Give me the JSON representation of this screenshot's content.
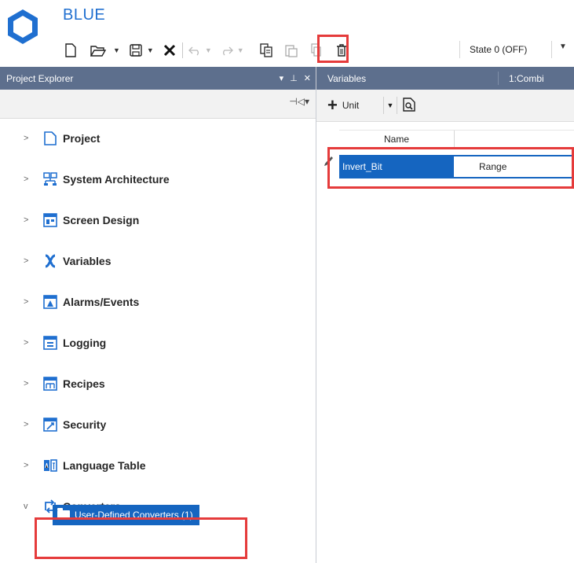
{
  "app": {
    "title": "BLUE"
  },
  "toolbar": {
    "items": [
      {
        "name": "new-file-icon"
      },
      {
        "name": "open-folder-icon"
      },
      {
        "name": "save-icon"
      },
      {
        "name": "close-icon"
      },
      {
        "name": "undo-icon"
      },
      {
        "name": "redo-icon"
      },
      {
        "name": "copy-icon"
      },
      {
        "name": "paste-icon"
      },
      {
        "name": "duplicate-icon"
      },
      {
        "name": "delete-icon"
      }
    ],
    "state_label": "State 0 (OFF)"
  },
  "project_explorer": {
    "header": "Project Explorer",
    "controls": [
      "▾",
      "⊥",
      "✕"
    ],
    "pin_glyph": "⊣◁▾",
    "tree": [
      {
        "label": "Project",
        "icon": "project-icon",
        "expanded": false
      },
      {
        "label": "System Architecture",
        "icon": "system-architecture-icon",
        "expanded": false
      },
      {
        "label": "Screen Design",
        "icon": "screen-design-icon",
        "expanded": false
      },
      {
        "label": "Variables",
        "icon": "variables-icon",
        "expanded": false
      },
      {
        "label": "Alarms/Events",
        "icon": "alarms-icon",
        "expanded": false
      },
      {
        "label": "Logging",
        "icon": "logging-icon",
        "expanded": false
      },
      {
        "label": "Recipes",
        "icon": "recipes-icon",
        "expanded": false
      },
      {
        "label": "Security",
        "icon": "security-icon",
        "expanded": false
      },
      {
        "label": "Language Table",
        "icon": "language-table-icon",
        "expanded": false
      },
      {
        "label": "Converters",
        "icon": "converters-icon",
        "expanded": true
      }
    ],
    "selected_child": "User-Defined Converters (1)"
  },
  "variables_panel": {
    "header": "Variables",
    "header_right": "1:Combi",
    "unit_button": "Unit",
    "columns": [
      "Name"
    ],
    "rows": [
      {
        "name": "Invert_Bit",
        "type": "Range"
      }
    ]
  },
  "colors": {
    "accent": "#1565c0",
    "header": "#5d6f8d",
    "highlight": "#e53b3b"
  }
}
